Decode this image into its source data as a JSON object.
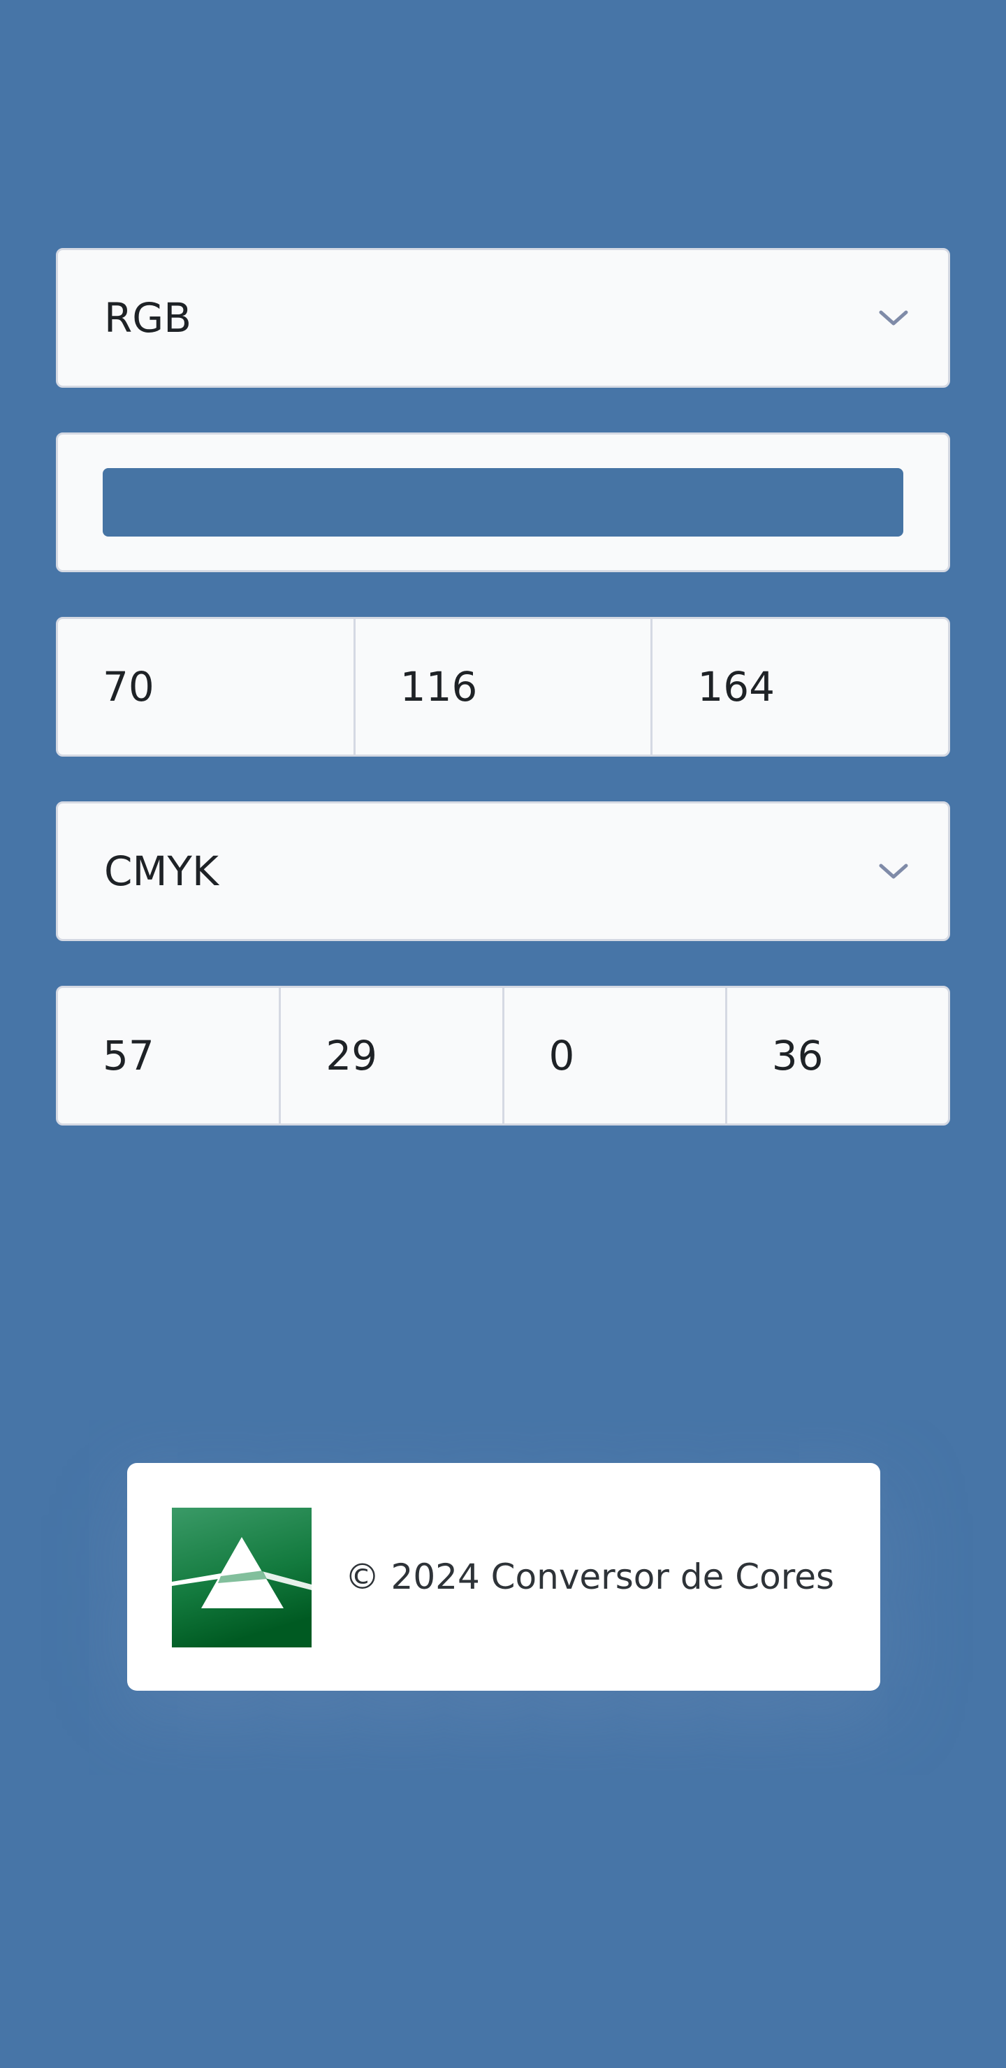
{
  "source_select": {
    "selected": "RGB"
  },
  "preview": {
    "color": "#4674a4"
  },
  "rgb_fields": {
    "r": "70",
    "g": "116",
    "b": "164"
  },
  "target_select": {
    "selected": "CMYK"
  },
  "cmyk_fields": {
    "c": "57",
    "m": "29",
    "y": "0",
    "k": "36"
  },
  "footer": {
    "copyright": "© 2024 Conversor de Cores",
    "logo_icon": "prism-logo-icon"
  },
  "colors": {
    "background": "#4775a7",
    "field_bg": "#f9fafb",
    "border": "#d5d9e3",
    "chevron": "#7f8ba8",
    "logo_green": "#1f8a4c"
  }
}
